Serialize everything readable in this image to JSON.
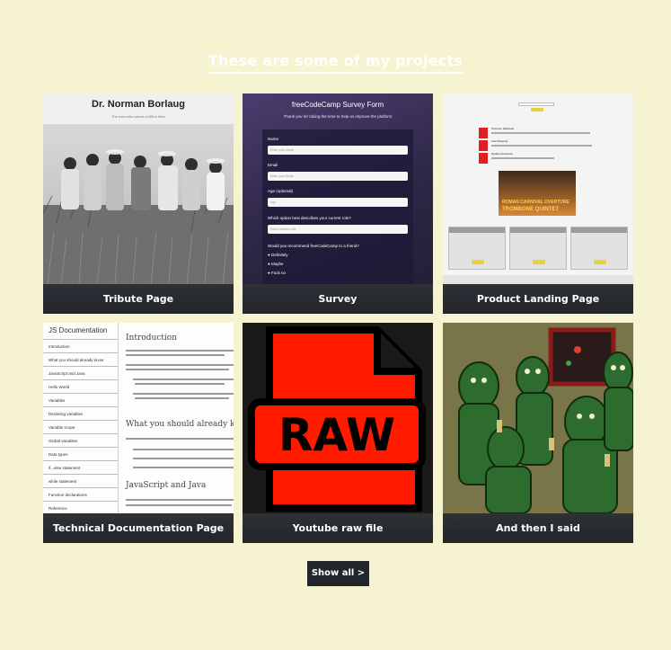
{
  "section_title": "These are some of my projects",
  "projects": [
    {
      "caption": "Tribute Page",
      "thumb": {
        "title": "Dr. Norman Borlaug",
        "subtitle": "The man who saved a billion lives"
      }
    },
    {
      "caption": "Survey",
      "thumb": {
        "title": "freeCodeCamp Survey Form",
        "subtitle": "Thank you for taking the time to help us improve the platform",
        "fields": [
          {
            "label": "Name",
            "placeholder": "Enter your name"
          },
          {
            "label": "Email",
            "placeholder": "Enter your Email"
          },
          {
            "label": "Age (optional)",
            "placeholder": "Age"
          },
          {
            "label": "Which option best describes your current role?",
            "placeholder": "Select current role"
          }
        ],
        "question": "Would you recommend freeCodeCamp to a friend?",
        "options": [
          "Definitely",
          "Maybe",
          "Fuck no"
        ]
      }
    },
    {
      "caption": "Product Landing Page",
      "thumb": {
        "features": [
          "Premium Materials",
          "Fast Shipping",
          "Quality Assurance"
        ],
        "video_text_1": "ROMAN CARNIVAL OVERTURE",
        "video_text_2": "TROMBONE QUINTET"
      }
    },
    {
      "caption": "Technical Documentation Page",
      "thumb": {
        "nav_title": "JS Documentation",
        "nav_items": [
          "Introduction",
          "What you should already know",
          "JavaScript and Java",
          "Hello World",
          "Variables",
          "Declaring variables",
          "Variable scope",
          "Global variables",
          "Data types",
          "if...else statement",
          "while statement",
          "Function declarations",
          "Reference"
        ],
        "headings": [
          "Introduction",
          "What you should already know",
          "JavaScript and Java"
        ]
      }
    },
    {
      "caption": "Youtube raw file",
      "thumb": {
        "label": "RAW"
      }
    },
    {
      "caption": "And then I said",
      "thumb": {}
    }
  ],
  "show_all_label": "Show all >",
  "colors": {
    "background": "#f5f3d0",
    "card_caption_bg": "#2a2e33",
    "raw_red": "#ff1a00",
    "product_red": "#e02020"
  }
}
